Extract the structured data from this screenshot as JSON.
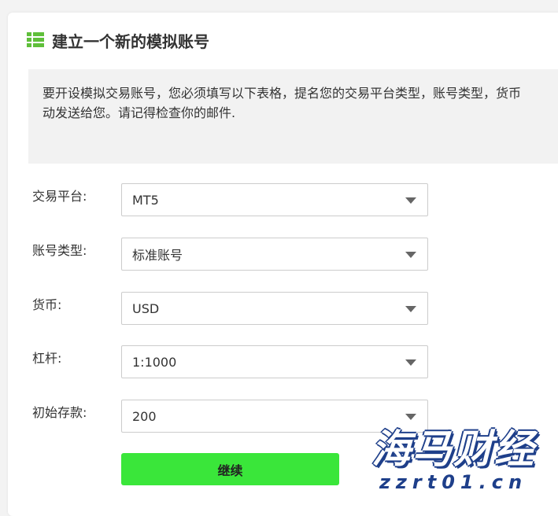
{
  "header": {
    "title": "建立一个新的模拟账号",
    "icon": "list-icon",
    "accent_color": "#5fbf3a"
  },
  "notice": {
    "line1": "要开设模拟交易账号，您必须填写以下表格，提名您的交易平台类型，账号类型，货币",
    "line2": "动发送给您。请记得检查你的邮件."
  },
  "form": {
    "platform": {
      "label": "交易平台:",
      "value": "MT5"
    },
    "account_type": {
      "label": "账号类型:",
      "value": "标准账号"
    },
    "currency": {
      "label": "货币:",
      "value": "USD"
    },
    "leverage": {
      "label": "杠杆:",
      "value": "1:1000"
    },
    "deposit": {
      "label": "初始存款:",
      "value": "200"
    }
  },
  "actions": {
    "continue_label": "继续",
    "continue_color": "#3ae63a"
  },
  "watermark": {
    "logo": "海马财经",
    "url": "zzrt01.cn",
    "color": "#1e3f8a"
  }
}
